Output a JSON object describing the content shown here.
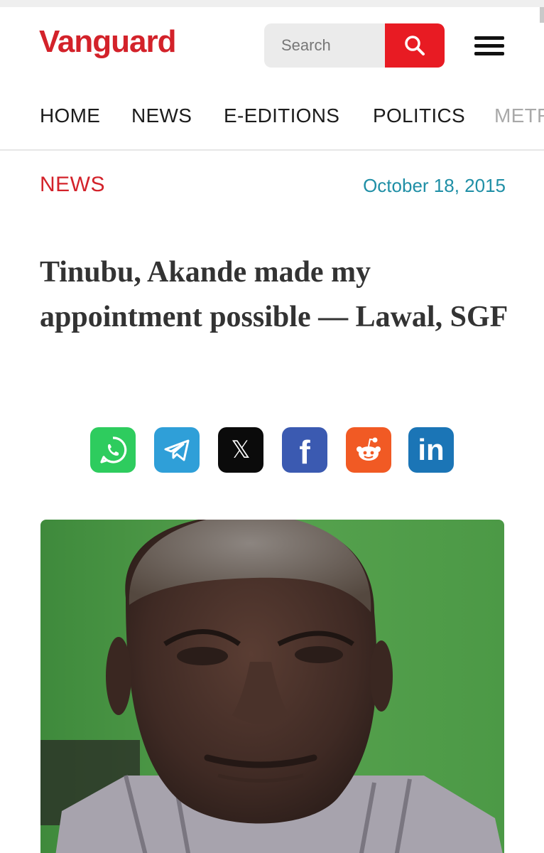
{
  "brand": {
    "name": "Vanguard",
    "color": "#d3222a"
  },
  "search": {
    "placeholder": "Search",
    "icon": "search-icon"
  },
  "menu": {
    "icon": "hamburger-icon"
  },
  "nav": {
    "items": [
      {
        "label": "HOME"
      },
      {
        "label": "NEWS"
      },
      {
        "label": "E-EDITIONS"
      },
      {
        "label": "POLITICS"
      },
      {
        "label": "METR"
      }
    ]
  },
  "article": {
    "category": "NEWS",
    "date": "October 18, 2015",
    "headline": "Tinubu, Akande made my appointment possible — Lawal, SGF",
    "image": {
      "description": "portrait-photo"
    }
  },
  "share": {
    "buttons": [
      {
        "name": "whatsapp",
        "icon": "whatsapp-icon",
        "color": "#2ecc5e"
      },
      {
        "name": "telegram",
        "icon": "telegram-icon",
        "color": "#2f9fd8"
      },
      {
        "name": "x",
        "icon": "x-icon",
        "color": "#0b0b0b"
      },
      {
        "name": "facebook",
        "icon": "facebook-icon",
        "color": "#3b5ab1"
      },
      {
        "name": "reddit",
        "icon": "reddit-icon",
        "color": "#f15a24"
      },
      {
        "name": "linkedin",
        "icon": "linkedin-icon",
        "color": "#1b75b6"
      }
    ]
  },
  "colors": {
    "accent": "#d3222a",
    "date": "#1f8fa6",
    "search_button": "#e81b23"
  }
}
